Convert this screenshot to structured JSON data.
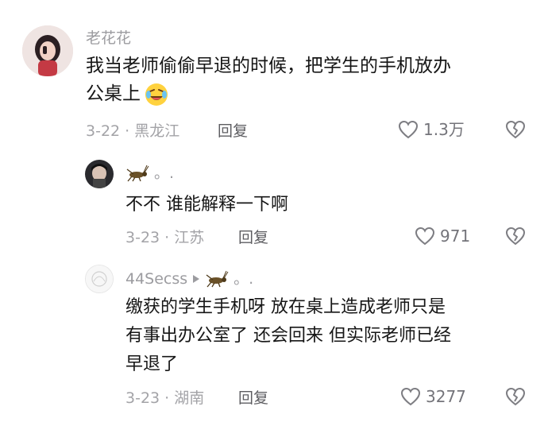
{
  "comments": [
    {
      "username": "老花花",
      "text_line1": "我当老师偷偷早退的时候，把学生的手机放办",
      "text_line2": "公桌上",
      "meta": "3-22 · 黑龙江",
      "reply_label": "回复",
      "likes": "1.3万"
    }
  ],
  "replies": [
    {
      "username": "",
      "name_suffix": "。.",
      "text": "不不 谁能解释一下啊",
      "meta": "3-23 · 江苏",
      "reply_label": "回复",
      "likes": "971"
    },
    {
      "username": "44Secss",
      "name_suffix": "。.",
      "text_line1": "缴获的学生手机呀 放在桌上造成老师只是",
      "text_line2": "有事出办公室了 还会回来 但实际老师已经",
      "text_line3": "早退了",
      "meta": "3-23 · 湖南",
      "reply_label": "回复",
      "likes": "3277"
    }
  ],
  "colors": {
    "name": "#9c9ca0",
    "text": "#161616",
    "meta": "#a3a3a7",
    "reply": "#5d5d61",
    "like_icon": "#7d7d82"
  },
  "icons": [
    "avatar",
    "emoji-laughing-crying-icon",
    "heart-outline-icon",
    "broken-heart-icon",
    "cricket-icon",
    "play-arrow-icon"
  ]
}
